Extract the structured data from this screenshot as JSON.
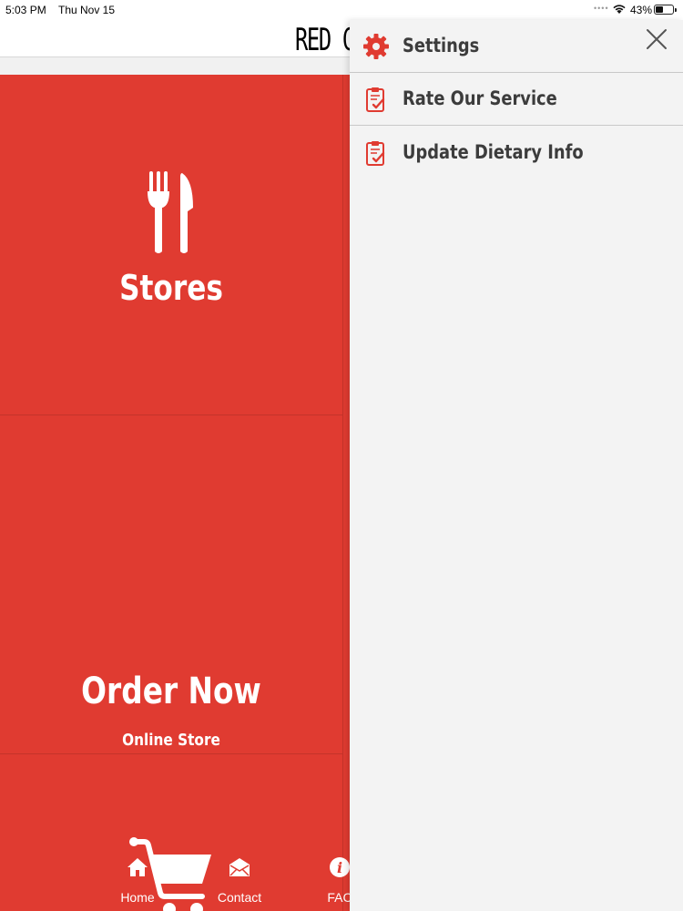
{
  "status_bar": {
    "time": "5:03 PM",
    "date": "Thu Nov 15",
    "battery": "43%",
    "battery_level": 0.43
  },
  "app": {
    "title_visible": "RED C",
    "accent_color": "#e03b31"
  },
  "tiles": [
    {
      "label": "Stores",
      "icon": "fork-knife-icon"
    },
    {
      "label": "Order Now",
      "sublabel": "Online Store",
      "icon": "shopping-cart-icon"
    }
  ],
  "tab_bar": {
    "items": [
      {
        "label": "Home",
        "icon": "home-icon"
      },
      {
        "label": "Contact",
        "icon": "envelope-icon"
      },
      {
        "label": "FAC",
        "icon": "info-icon"
      }
    ]
  },
  "drawer": {
    "items": [
      {
        "label": "Settings",
        "icon": "gear-icon"
      },
      {
        "label": "Rate Our Service",
        "icon": "clipboard-check-icon"
      },
      {
        "label": "Update Dietary Info",
        "icon": "clipboard-check-icon"
      }
    ],
    "close_icon": "close-icon"
  }
}
